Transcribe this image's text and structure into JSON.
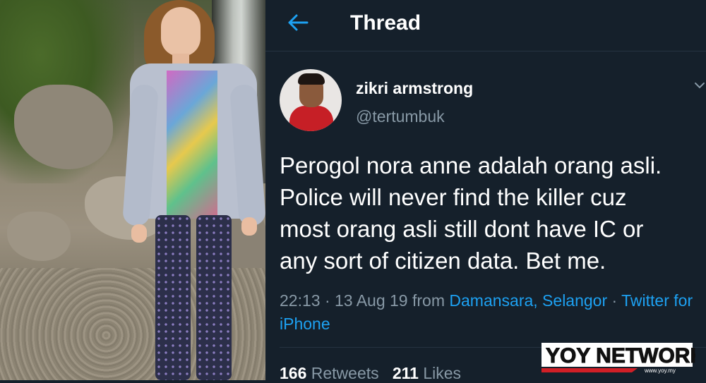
{
  "header": {
    "title": "Thread"
  },
  "tweet": {
    "display_name": "zikri armstrong",
    "handle": "@tertumbuk",
    "text_lines": [
      "Perogol nora anne adalah orang asli.",
      "Police will never find the killer cuz",
      "most orang asli still dont have IC or",
      "any sort of citizen data. Bet  me."
    ],
    "time_date": "22:13 · 13 Aug 19 from ",
    "location": "Damansara, Selangor",
    "separator": " · ",
    "source": "Twitter for iPhone"
  },
  "stats": {
    "retweets_count": "166",
    "retweets_label": "Retweets",
    "likes_count": "211",
    "likes_label": "Likes"
  },
  "watermark": {
    "brand": "YOY NETWORK",
    "url": "www.yoy.my"
  },
  "colors": {
    "background": "#15202b",
    "accent": "#1da1f2",
    "secondary_text": "#8899a6"
  },
  "icons": {
    "back": "back-arrow-icon",
    "caret": "chevron-down-icon"
  }
}
